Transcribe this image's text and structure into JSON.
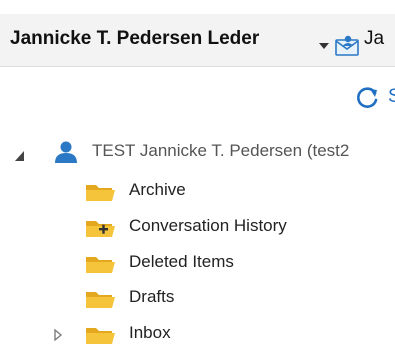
{
  "header": {
    "account_name": "Jannicke T. Pedersen Leder",
    "mail_label": "Ja"
  },
  "toolbar": {
    "sync_label": "S"
  },
  "tree": {
    "root_label": "TEST Jannicke T. Pedersen (test2",
    "folders": [
      {
        "label": "Archive",
        "icon": "folder-icon"
      },
      {
        "label": "Conversation History",
        "icon": "folder-plus-icon"
      },
      {
        "label": "Deleted Items",
        "icon": "folder-icon"
      },
      {
        "label": "Drafts",
        "icon": "folder-icon"
      },
      {
        "label": "Inbox",
        "icon": "folder-icon"
      }
    ]
  },
  "colors": {
    "header_bg": "#f3f3f3",
    "accent_blue": "#1f6fc2",
    "folder_yellow": "#f6c43b"
  }
}
